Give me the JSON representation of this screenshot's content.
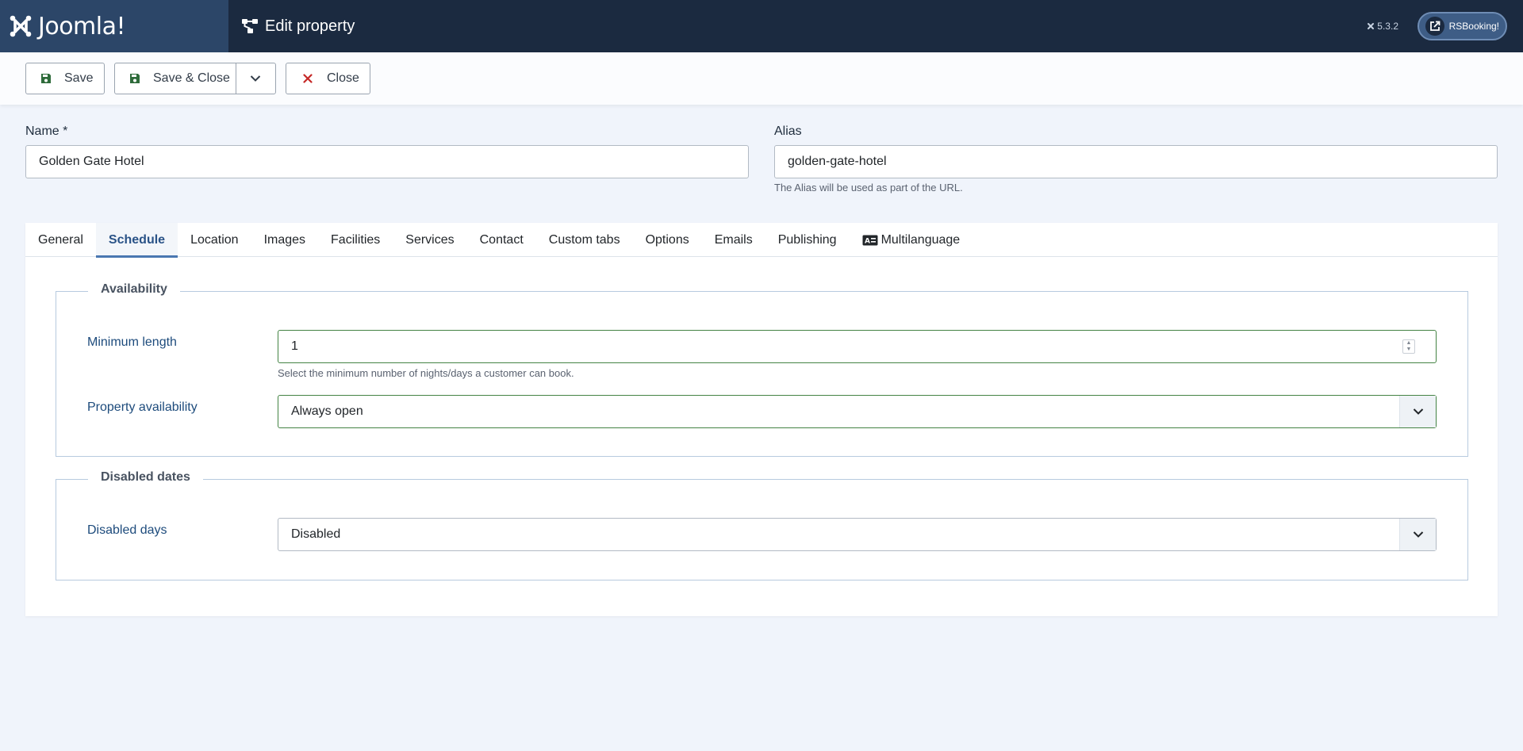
{
  "header": {
    "logo_text": "Joomla!",
    "page_title": "Edit property",
    "version": "5.3.2",
    "site_button_label": "RSBooking!"
  },
  "toolbar": {
    "save_label": "Save",
    "save_close_label": "Save & Close",
    "close_label": "Close"
  },
  "form": {
    "name_label": "Name *",
    "name_value": "Golden Gate Hotel",
    "alias_label": "Alias",
    "alias_value": "golden-gate-hotel",
    "alias_hint": "The Alias will be used as part of the URL."
  },
  "tabs": [
    {
      "label": "General"
    },
    {
      "label": "Schedule",
      "active": true
    },
    {
      "label": "Location"
    },
    {
      "label": "Images"
    },
    {
      "label": "Facilities"
    },
    {
      "label": "Services"
    },
    {
      "label": "Contact"
    },
    {
      "label": "Custom tabs"
    },
    {
      "label": "Options"
    },
    {
      "label": "Emails"
    },
    {
      "label": "Publishing"
    },
    {
      "label": "Multilanguage",
      "icon": "language-card-icon"
    }
  ],
  "availability": {
    "legend": "Availability",
    "min_length_label": "Minimum length",
    "min_length_value": "1",
    "min_length_hint": "Select the minimum number of nights/days a customer can book.",
    "property_availability_label": "Property availability",
    "property_availability_value": "Always open"
  },
  "disabled_dates": {
    "legend": "Disabled dates",
    "disabled_days_label": "Disabled days",
    "disabled_days_value": "Disabled"
  },
  "colors": {
    "header_bg": "#1b2a40",
    "logo_bg": "#2c4668",
    "accent": "#2a5387",
    "valid_border": "#448344",
    "close_red": "#c52827",
    "save_green": "#2e6b3a"
  }
}
